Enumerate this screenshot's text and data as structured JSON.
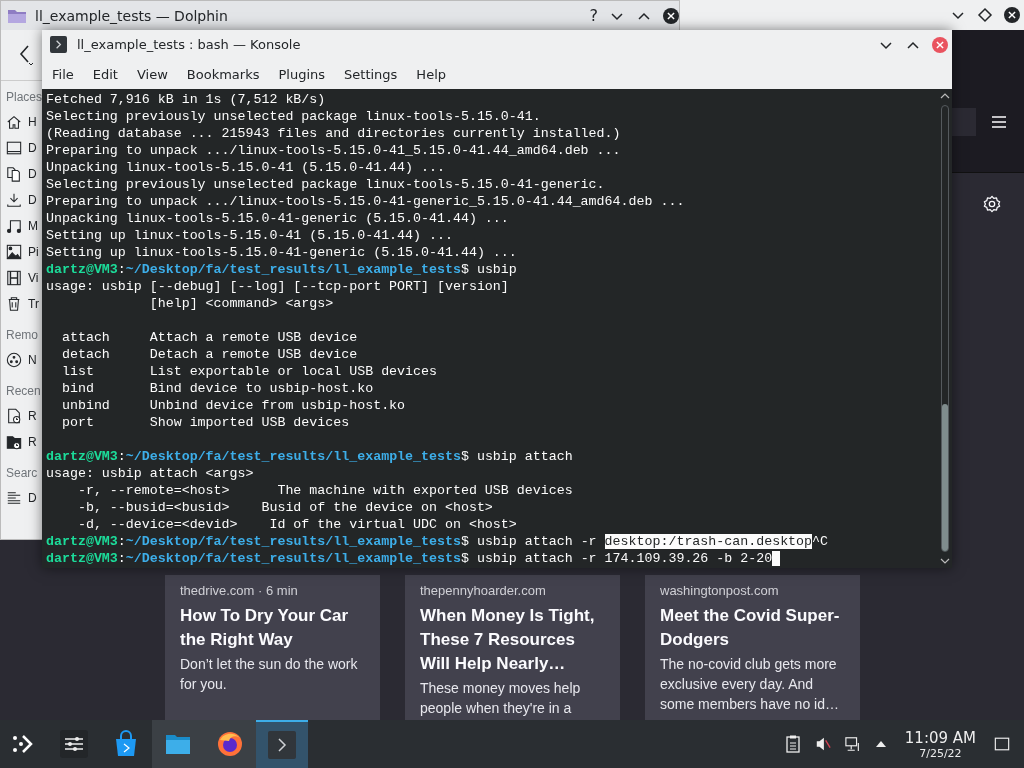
{
  "dolphin": {
    "title": "ll_example_tests — Dolphin",
    "help": "?",
    "sidebar": [
      {
        "heading": "Places",
        "items": [
          {
            "kind": "home",
            "label": "H"
          },
          {
            "kind": "drive",
            "label": "D"
          },
          {
            "kind": "documents",
            "label": "D"
          },
          {
            "kind": "downloads",
            "label": "D"
          },
          {
            "kind": "music",
            "label": "M"
          },
          {
            "kind": "pictures",
            "label": "Pi"
          },
          {
            "kind": "videos",
            "label": "Vi"
          },
          {
            "kind": "trash",
            "label": "Tr"
          }
        ]
      },
      {
        "heading": "Remo",
        "items": [
          {
            "kind": "network",
            "label": "N"
          }
        ]
      },
      {
        "heading": "Recen",
        "items": [
          {
            "kind": "recent_files",
            "label": "R"
          },
          {
            "kind": "recent_locations",
            "label": "R"
          }
        ]
      },
      {
        "heading": "Searc",
        "items": [
          {
            "kind": "text",
            "label": "D"
          }
        ]
      }
    ]
  },
  "konsole": {
    "title": "ll_example_tests : bash — Konsole",
    "menu": [
      "File",
      "Edit",
      "View",
      "Bookmarks",
      "Plugins",
      "Settings",
      "Help"
    ],
    "lines": [
      {
        "kind": "output",
        "text": "Fetched 7,916 kB in 1s (7,512 kB/s)"
      },
      {
        "kind": "output",
        "text": "Selecting previously unselected package linux-tools-5.15.0-41."
      },
      {
        "kind": "output",
        "text": "(Reading database ... 215943 files and directories currently installed.)"
      },
      {
        "kind": "output",
        "text": "Preparing to unpack .../linux-tools-5.15.0-41_5.15.0-41.44_amd64.deb ..."
      },
      {
        "kind": "output",
        "text": "Unpacking linux-tools-5.15.0-41 (5.15.0-41.44) ..."
      },
      {
        "kind": "output",
        "text": "Selecting previously unselected package linux-tools-5.15.0-41-generic."
      },
      {
        "kind": "output",
        "text": "Preparing to unpack .../linux-tools-5.15.0-41-generic_5.15.0-41.44_amd64.deb ..."
      },
      {
        "kind": "output",
        "text": "Unpacking linux-tools-5.15.0-41-generic (5.15.0-41.44) ..."
      },
      {
        "kind": "output",
        "text": "Setting up linux-tools-5.15.0-41 (5.15.0-41.44) ..."
      },
      {
        "kind": "output",
        "text": "Setting up linux-tools-5.15.0-41-generic (5.15.0-41.44) ..."
      },
      {
        "kind": "prompt",
        "user": "dartz@VM3",
        "separator": ":",
        "path": "~/Desktop/fa/test_results/ll_example_tests",
        "symbol": "$",
        "command": "usbip"
      },
      {
        "kind": "output",
        "text": "usage: usbip [--debug] [--log] [--tcp-port PORT] [version]"
      },
      {
        "kind": "output",
        "text": "             [help] <command> <args>"
      },
      {
        "kind": "blank"
      },
      {
        "kind": "output",
        "text": "  attach     Attach a remote USB device"
      },
      {
        "kind": "output",
        "text": "  detach     Detach a remote USB device"
      },
      {
        "kind": "output",
        "text": "  list       List exportable or local USB devices"
      },
      {
        "kind": "output",
        "text": "  bind       Bind device to usbip-host.ko"
      },
      {
        "kind": "output",
        "text": "  unbind     Unbind device from usbip-host.ko"
      },
      {
        "kind": "output",
        "text": "  port       Show imported USB devices"
      },
      {
        "kind": "blank"
      },
      {
        "kind": "prompt",
        "user": "dartz@VM3",
        "separator": ":",
        "path": "~/Desktop/fa/test_results/ll_example_tests",
        "symbol": "$",
        "command": "usbip attach"
      },
      {
        "kind": "output",
        "text": "usage: usbip attach <args>"
      },
      {
        "kind": "output",
        "text": "    -r, --remote=<host>      The machine with exported USB devices"
      },
      {
        "kind": "output",
        "text": "    -b, --busid=<busid>    Busid of the device on <host>"
      },
      {
        "kind": "output",
        "text": "    -d, --device=<devid>    Id of the virtual UDC on <host>"
      },
      {
        "kind": "prompt",
        "user": "dartz@VM3",
        "separator": ":",
        "path": "~/Desktop/fa/test_results/ll_example_tests",
        "symbol": "$",
        "command": "usbip attach -r",
        "selection": "desktop:/trash-can.desktop",
        "after": "^C"
      },
      {
        "kind": "prompt",
        "user": "dartz@VM3",
        "separator": ":",
        "path": "~/Desktop/fa/test_results/ll_example_tests",
        "symbol": "$",
        "command": "usbip attach -r 174.109.39.26 -b 2-20",
        "cursor": true
      }
    ]
  },
  "news_cards": [
    {
      "source": "thedrive.com · 6 min",
      "title": "How To Dry Your Car the Right Way",
      "summary": "Don’t let the sun do the work for you."
    },
    {
      "source": "thepennyhoarder.com",
      "title": "When Money Is Tight, These 7 Resources Will Help Nearly…",
      "summary": "These money moves help people when they're in a"
    },
    {
      "source": "washingtonpost.com",
      "title": "Meet the Covid Super-Dodgers",
      "summary": "The no-covid club gets more exclusive every day. And some members have no id…"
    }
  ],
  "taskbar": {
    "apps": [
      {
        "kind": "settings",
        "open": false,
        "selected": false
      },
      {
        "kind": "store",
        "open": false,
        "selected": false
      },
      {
        "kind": "files",
        "open": true,
        "selected": false
      },
      {
        "kind": "browser",
        "open": true,
        "selected": false
      },
      {
        "kind": "terminal",
        "open": true,
        "selected": true
      }
    ],
    "volume_muted": true,
    "clock": {
      "time": "11:09 AM",
      "date": "7/25/22"
    }
  }
}
